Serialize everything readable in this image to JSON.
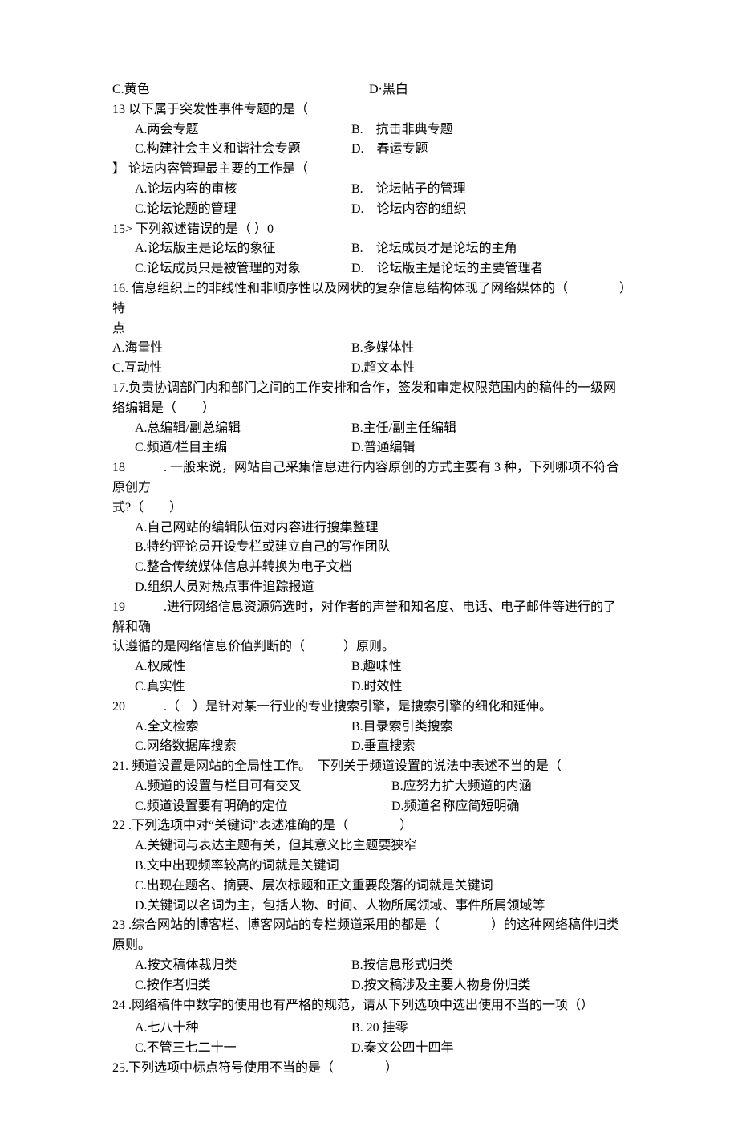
{
  "top": {
    "c": "C.黄色",
    "d": "D·黑白"
  },
  "q13": {
    "stem": "13  以下属于突发性事件专题的是（",
    "a": "A.两会专题",
    "b": "B.　抗击非典专题",
    "c": "C.构建社会主义和谐社会专题",
    "d": "D.　春运专题"
  },
  "q14": {
    "stem": "】  论坛内容管理最主要的工作是（",
    "a": "A.论坛内容的审核",
    "b": "B.　论坛帖子的管理",
    "c": "C.论坛论题的管理",
    "d": "D.　论坛内容的组织"
  },
  "q15": {
    "stem": "15> 下列叙述错误的是（             ）0",
    "a": "A.论坛版主是论坛的象征",
    "b": "B.　论坛成员才是论坛的主角",
    "c": "C.论坛成员只是被管理的对象",
    "d": "D.　论坛版主是论坛的主要管理者"
  },
  "q16": {
    "stem": "16.  信息组织上的非线性和非顺序性以及网状的复杂信息结构体现了网络媒体的（　　　　）特",
    "stem2": "点",
    "a": "A.海量性",
    "b": "B.多媒体性",
    "c": "C.互动性",
    "d": "D.超文本性"
  },
  "q17": {
    "stem": "17.负责协调部门内和部门之间的工作安排和合作，签发和审定权限范围内的稿件的一级网",
    "stem2": "络编辑是（　　）",
    "a": "A.总编辑/副总编辑",
    "b": "B.主任/副主任编辑",
    "c": "C.频道/栏目主编",
    "d": "D.普通编辑"
  },
  "q18": {
    "stem": "18　　　. 一般来说，网站自己采集信息进行内容原创的方式主要有 3 种，下列哪项不符合原创方",
    "stem2": "式?（　　）",
    "a": "A.自己网站的编辑队伍对内容进行搜集整理",
    "b": "B.特约评论员开设专栏或建立自己的写作团队",
    "c": "C.整合传统媒体信息并转换为电子文档",
    "d": "D.组织人员对热点事件追踪报道"
  },
  "q19": {
    "stem": "19　　　.进行网络信息资源筛选时，对作者的声誉和知名度、电话、电子邮件等进行的了解和确",
    "stem2": "认遵循的是网络信息价值判断的（　　　）原则。",
    "a": "A.权威性",
    "b": "B.趣味性",
    "c": "C.真实性",
    "d": "D.时效性"
  },
  "q20": {
    "stem": "20　　　.（　）是针对某一行业的专业搜索引擎，是搜索引擎的细化和延伸。",
    "a": "A.全文检索",
    "b": "B.目录索引类搜索",
    "c": "C.网络数据库搜索",
    "d": "D.垂直搜索"
  },
  "q21": {
    "stem": "21.  频道设置是网站的全局性工作。　下列关于频道设置的说法中表述不当的是（",
    "a": "A.频道的设置与栏目可有交叉",
    "b": "B.应努力扩大频道的内涵",
    "c": "C.频道设置要有明确的定位",
    "d": "D.频道名称应简短明确"
  },
  "q22": {
    "stem": "22 .下列选项中对“关键词”表述准确的是（　　　　）",
    "a": "A.关键词与表达主题有关，但其意义比主题要狭窄",
    "b": "B.文中出现频率较高的词就是关键词",
    "c": "C.出现在题名、摘要、层次标题和正文重要段落的词就是关键词",
    "d": "D.关键词以名词为主，包括人物、时间、人物所属领域、事件所属领域等"
  },
  "q23": {
    "stem": "23 .综合网站的博客栏、博客网站的专栏频道采用的都是（　　　　）的这种网络稿件归类原则。",
    "a": "A.按文稿体裁归类",
    "b": "B.按信息形式归类",
    "c": "C.按作者归类",
    "d": "D.按文稿涉及主要人物身份归类"
  },
  "q24": {
    "stem": "24 .网络稿件中数字的使用也有严格的规范，请从下列选项中选出使用不当的一项（）",
    "a": "A.七八十种",
    "b": "B. 20 挂零",
    "c": "C.不管三七二十一",
    "d": "D.秦文公四十四年"
  },
  "q25": {
    "stem": "25.下列选项中标点符号使用不当的是（　　　　）"
  }
}
